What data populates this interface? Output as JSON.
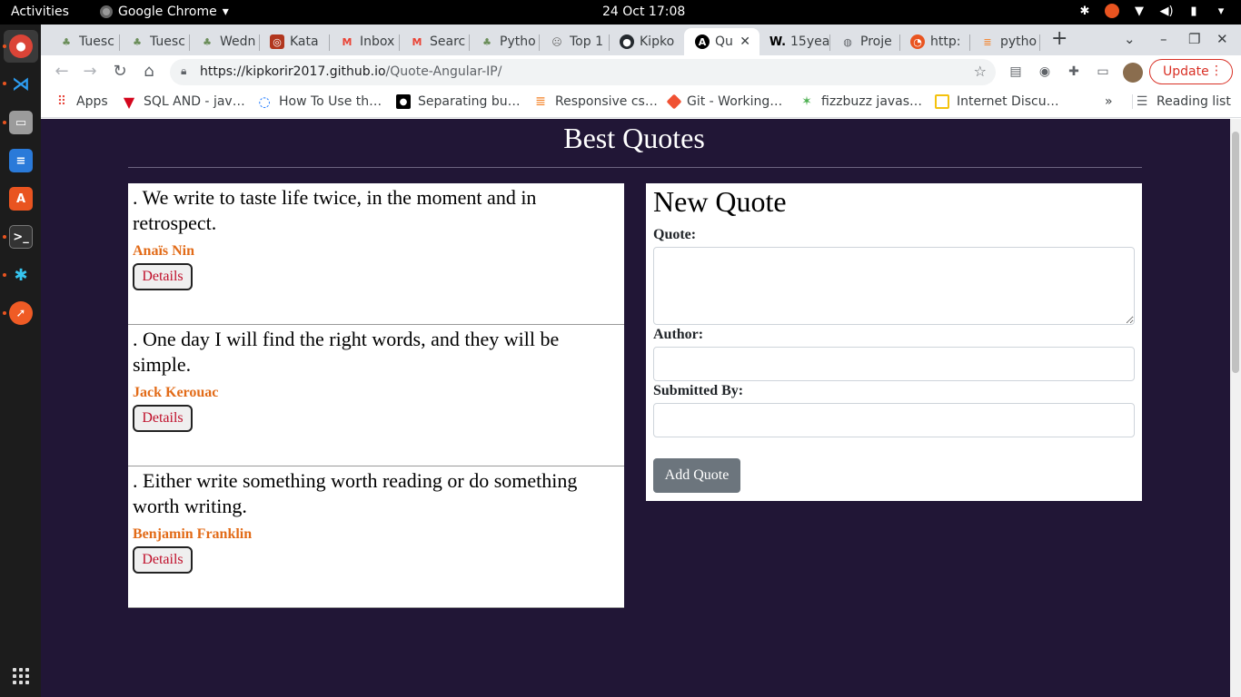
{
  "system": {
    "activities": "Activities",
    "app_name": "Google Chrome",
    "clock": "24 Oct  17:08"
  },
  "tabs": [
    {
      "label": "Tuesc",
      "fav_color": "#6b8e5a",
      "fav": "tree"
    },
    {
      "label": "Tuesc",
      "fav_color": "#6b8e5a",
      "fav": "tree"
    },
    {
      "label": "Wedn",
      "fav_color": "#6b8e5a",
      "fav": "tree"
    },
    {
      "label": "Kata",
      "fav_color": "#b1361e",
      "fav": "codewars"
    },
    {
      "label": "Inbox",
      "fav_color": "#ea4335",
      "fav": "gmail"
    },
    {
      "label": "Searc",
      "fav_color": "#ea4335",
      "fav": "gmail"
    },
    {
      "label": "Pytho",
      "fav_color": "#6b8e5a",
      "fav": "tree"
    },
    {
      "label": "Top 1",
      "fav_color": "#666666",
      "fav": "face"
    },
    {
      "label": "Kipko",
      "fav_color": "#24292e",
      "fav": "github"
    },
    {
      "label": "Qu",
      "fav_color": "#000000",
      "fav": "angular",
      "active": true
    },
    {
      "label": "15yea",
      "fav_color": "#000000",
      "fav": "wikipedia"
    },
    {
      "label": "Proje",
      "fav_color": "#5f6368",
      "fav": "globe"
    },
    {
      "label": "http:",
      "fav_color": "#e95420",
      "fav": "ubuntu"
    },
    {
      "label": "pytho",
      "fav_color": "#f48024",
      "fav": "stackoverflow"
    }
  ],
  "toolbar": {
    "url_host": "https://kipkorir2017.github.io",
    "url_path": "/Quote-Angular-IP/",
    "update_label": "Update"
  },
  "bookmarks": [
    {
      "label": "Apps",
      "color": "#e8453c"
    },
    {
      "label": "SQL AND - jav…",
      "color": "#d4061d"
    },
    {
      "label": "How To Use th…",
      "color": "#0069ff"
    },
    {
      "label": "Separating bu…",
      "color": "#000000"
    },
    {
      "label": "Responsive cs…",
      "color": "#f48024"
    },
    {
      "label": "Git - Working…",
      "color": "#f05133"
    },
    {
      "label": "fizzbuzz javas…",
      "color": "#4caf50"
    },
    {
      "label": "Internet Discu…",
      "color": "#f4c20d"
    }
  ],
  "reading_list": "Reading list",
  "more_bookmarks": "»",
  "page": {
    "title": "Best Quotes",
    "quotes": [
      {
        "text": ". We write to taste life twice, in the moment and in retrospect.",
        "author": "Anaïs Nin",
        "button": "Details"
      },
      {
        "text": ". One day I will find the right words, and they will be simple.",
        "author": "Jack Kerouac",
        "button": "Details"
      },
      {
        "text": ". Either write something worth reading or do something worth writing.",
        "author": "Benjamin Franklin",
        "button": "Details"
      }
    ],
    "form": {
      "title": "New Quote",
      "quote_label": "Quote:",
      "author_label": "Author:",
      "submitted_label": "Submitted By:",
      "submit": "Add Quote"
    }
  },
  "colors": {
    "page_bg": "#211636",
    "author": "#e26b18",
    "details_text": "#c0102b",
    "add_button": "#6c757d"
  }
}
